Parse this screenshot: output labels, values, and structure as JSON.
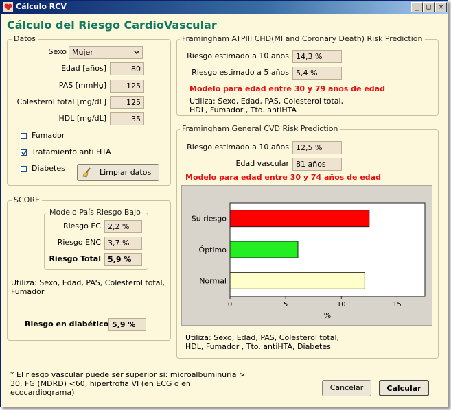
{
  "window": {
    "title": "Cálculo RCV",
    "buttons": {
      "minimize": "_",
      "maximize": "□",
      "close": "✕"
    }
  },
  "heading": "Cálculo del Riesgo CardioVascular",
  "datos": {
    "legend": "Datos",
    "sexo": {
      "label": "Sexo",
      "value": "Mujer"
    },
    "edad": {
      "label": "Edad [años]",
      "value": "80"
    },
    "pas": {
      "label": "PAS [mmHg]",
      "value": "125"
    },
    "colesterol": {
      "label": "Colesterol total [mg/dL]",
      "value": "125"
    },
    "hdl": {
      "label": "HDL [mg/dL]",
      "value": "35"
    },
    "fumador": {
      "label": "Fumador",
      "checked": false
    },
    "tratamiento": {
      "label": "Tratamiento anti HTA",
      "checked": true
    },
    "diabetes": {
      "label": "Diabetes",
      "checked": false
    },
    "limpiar_label": "Limpiar datos"
  },
  "score": {
    "legend": "SCORE",
    "modelo_legend": "Modelo País Riesgo Bajo",
    "riesgo_ec": {
      "label": "Riesgo EC",
      "value": "2,2 %"
    },
    "riesgo_enc": {
      "label": "Riesgo ENC",
      "value": "3,7 %"
    },
    "riesgo_total": {
      "label": "Riesgo Total",
      "value": "5,9 %"
    },
    "utiliza": "Utiliza: Sexo, Edad, PAS, Colesterol total, Fumador",
    "diabeticos": {
      "label": "Riesgo en diabéticos",
      "value": "5,9 %"
    }
  },
  "atp": {
    "legend": "Framingham ATPIII CHD(MI and Coronary Death) Risk Prediction",
    "r10": {
      "label": "Riesgo estimado a 10 años",
      "value": "14,3 %"
    },
    "r5": {
      "label": "Riesgo estimado a 5 años",
      "value": "5,4 %"
    },
    "modelo": "Modelo para edad entre 30 y 79 años de edad",
    "utiliza": "Utiliza: Sexo, Edad, PAS, Colesterol total, HDL, Fumador , Tto. antiHTA"
  },
  "cvd": {
    "legend": "Framingham General CVD Risk Prediction",
    "r10": {
      "label": "Riesgo estimado a 10 años",
      "value": "12,5 %"
    },
    "edad_vascular": {
      "label": "Edad vascular",
      "value": "81 años"
    },
    "modelo": "Modelo para edad entre 30 y 74 años de edad",
    "utiliza": "Utiliza: Sexo, Edad, PAS, Colesterol total, HDL, Fumador , Tto. antiHTA, Diabetes"
  },
  "chart_data": {
    "type": "bar",
    "orientation": "horizontal",
    "categories": [
      "Su riesgo",
      "Óptimo",
      "Normal"
    ],
    "values": [
      12.5,
      6.1,
      12.1
    ],
    "colors": [
      "#ff0000",
      "#22ee22",
      "#ffffcc"
    ],
    "xlabel": "%",
    "xlim": [
      0,
      17.5
    ],
    "ticks": [
      0,
      5,
      10,
      15
    ],
    "tick_labels": [
      "0",
      "5",
      "10",
      "15"
    ],
    "grid": false
  },
  "footnote": "* El riesgo vascular puede ser superior si: microalbuminuria > 30, FG (MDRD) <60, hipertrofia VI (en ECG  o en ecocardiograma)",
  "buttons": {
    "cancelar": "Cancelar",
    "calcular": "Calcular"
  },
  "colors": {
    "heading": "#107a5e",
    "warning": "#e81010",
    "window_bg": "#fdf7db",
    "titlebar": "#0a246a"
  }
}
